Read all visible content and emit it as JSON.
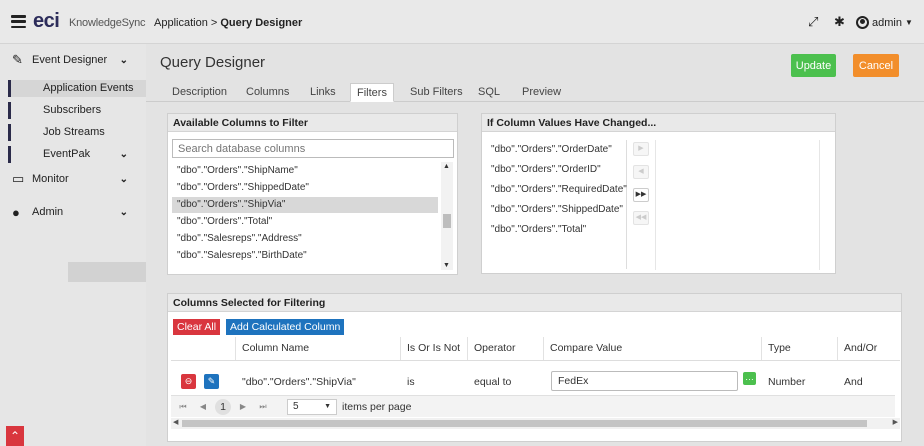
{
  "topbar": {
    "logo": "eci",
    "logo_sub": "KnowledgeSync",
    "breadcrumb_prefix": "Application > ",
    "breadcrumb_current": "Query Designer",
    "user": "admin"
  },
  "sidebar": {
    "sections": [
      {
        "label": "Event Designer",
        "icon": "edit-icon"
      },
      {
        "label": "Monitor",
        "icon": "monitor-icon"
      },
      {
        "label": "Admin",
        "icon": "user-icon"
      }
    ],
    "event_designer_items": [
      "Application Events",
      "Subscribers",
      "Job Streams",
      "EventPak"
    ]
  },
  "page": {
    "title": "Query Designer",
    "update_label": "Update",
    "cancel_label": "Cancel",
    "tabs": [
      "Description",
      "Columns",
      "Links",
      "Filters",
      "Sub Filters",
      "SQL",
      "Preview"
    ],
    "active_tab": "Filters"
  },
  "available": {
    "header": "Available Columns to Filter",
    "search_placeholder": "Search database columns",
    "items": [
      "\"dbo\".\"Orders\".\"ShipName\"",
      "\"dbo\".\"Orders\".\"ShippedDate\"",
      "\"dbo\".\"Orders\".\"ShipVia\"",
      "\"dbo\".\"Orders\".\"Total\"",
      "\"dbo\".\"Salesreps\".\"Address\"",
      "\"dbo\".\"Salesreps\".\"BirthDate\""
    ],
    "selected_index": 2
  },
  "changed": {
    "header": "If Column Values Have Changed...",
    "items": [
      "\"dbo\".\"Orders\".\"OrderDate\"",
      "\"dbo\".\"Orders\".\"OrderID\"",
      "\"dbo\".\"Orders\".\"RequiredDate\"",
      "\"dbo\".\"Orders\".\"ShippedDate\"",
      "\"dbo\".\"Orders\".\"Total\""
    ]
  },
  "filtering": {
    "header": "Columns Selected for Filtering",
    "clear_all_label": "Clear All",
    "add_calc_label": "Add Calculated Column",
    "columns": [
      "Column Name",
      "Is Or Is Not",
      "Operator",
      "Compare Value",
      "Type",
      "And/Or"
    ],
    "row": {
      "column_name": "\"dbo\".\"Orders\".\"ShipVia\"",
      "is_or_is_not": "is",
      "operator": "equal to",
      "compare_value": "FedEx",
      "type": "Number",
      "and_or": "And"
    },
    "pager": {
      "current_page": "1",
      "page_size": "5",
      "items_per_page_label": "items per page"
    }
  },
  "colors": {
    "update": "#4cc04e",
    "cancel": "#f28e2b",
    "clear_all": "#d9363e",
    "add_calc": "#1e73be"
  }
}
